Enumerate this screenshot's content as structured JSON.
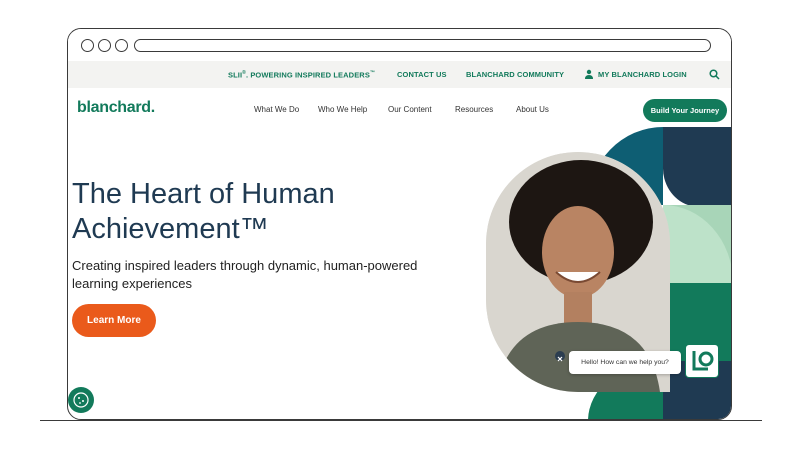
{
  "utility_bar": {
    "sli_text": "SLII",
    "sli_rest": ". POWERING INSPIRED LEADERS",
    "contact": "CONTACT US",
    "community": "BLANCHARD COMMUNITY",
    "login": "MY BLANCHARD LOGIN"
  },
  "nav": {
    "logo": "blanchard",
    "items": [
      "What We Do",
      "Who We Help",
      "Our Content",
      "Resources",
      "About Us"
    ],
    "cta": "Build Your Journey"
  },
  "hero": {
    "title": "The Heart of Human Achievement™",
    "subtitle": "Creating inspired leaders through dynamic, human-powered learning experiences",
    "button": "Learn More"
  },
  "chat": {
    "message": "Hello! How can we help you?"
  },
  "colors": {
    "brand_green": "#127a5b",
    "navy": "#1f3a52",
    "orange": "#ea5a1b",
    "light_green": "#a8d5b8",
    "teal": "#0e7c6b"
  },
  "icons": {
    "person": "person-icon",
    "search": "search-icon",
    "close": "close-icon",
    "cookie": "cookie-icon",
    "chat_logo": "chat-logo-icon"
  }
}
